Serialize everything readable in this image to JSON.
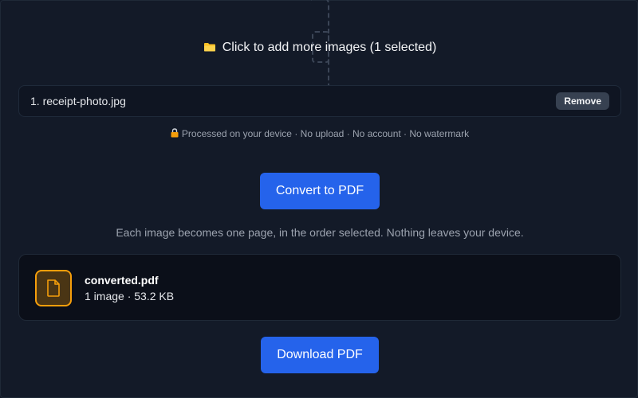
{
  "dropzone": {
    "label": "Click to add more images (1 selected)",
    "icon": "folder-icon"
  },
  "files": [
    {
      "name": "1. receipt-photo.jpg",
      "remove_label": "Remove"
    }
  ],
  "privacy": {
    "icon": "lock-icon",
    "text": "Processed on your device · No upload · No account · No watermark"
  },
  "actions": {
    "convert_label": "Convert to PDF",
    "download_label": "Download PDF"
  },
  "hint": "Each image becomes one page, in the order selected. Nothing leaves your device.",
  "result": {
    "icon": "pdf-file-icon",
    "filename": "converted.pdf",
    "meta": "1 image · 53.2 KB"
  },
  "colors": {
    "background": "#131a28",
    "accent": "#2563eb",
    "file_icon_accent": "#f59e0b"
  }
}
